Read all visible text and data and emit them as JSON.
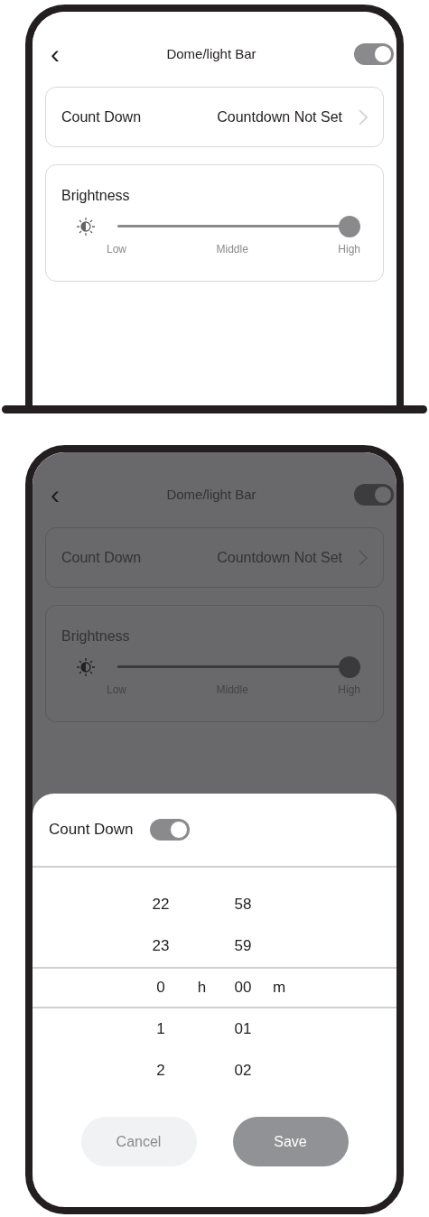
{
  "screens": [
    {
      "dimmed": false,
      "header": {
        "back": "‹",
        "title": "Dome/light Bar",
        "toggle_on": true
      },
      "countdown_row": {
        "label": "Count Down",
        "value": "Countdown Not Set"
      },
      "brightness": {
        "title": "Brightness",
        "level": 1,
        "labels": [
          "Low",
          "Middle",
          "High"
        ]
      }
    },
    {
      "dimmed": true,
      "header": {
        "back": "‹",
        "title": "Dome/light Bar",
        "toggle_on": true
      },
      "countdown_row": {
        "label": "Count Down",
        "value": "Countdown Not Set"
      },
      "brightness": {
        "title": "Brightness",
        "level": 1,
        "labels": [
          "Low",
          "Middle",
          "High"
        ]
      },
      "sheet": {
        "title": "Count Down",
        "toggle_on": true,
        "hour_unit": "h",
        "minute_unit": "m",
        "rows": [
          {
            "hour": "22",
            "minute": "58",
            "selected": false
          },
          {
            "hour": "23",
            "minute": "59",
            "selected": false
          },
          {
            "hour": "0",
            "minute": "00",
            "selected": true
          },
          {
            "hour": "1",
            "minute": "01",
            "selected": false
          },
          {
            "hour": "2",
            "minute": "02",
            "selected": false
          }
        ],
        "buttons": [
          {
            "label": "Cancel",
            "kind": "secondary"
          },
          {
            "label": "Save",
            "kind": "primary"
          }
        ]
      }
    }
  ]
}
